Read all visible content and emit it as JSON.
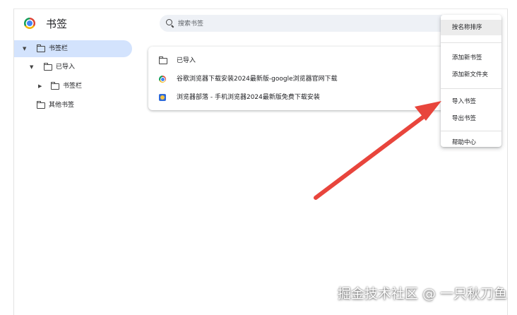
{
  "header": {
    "title": "书签"
  },
  "search": {
    "placeholder": "搜索书签"
  },
  "sidebar": {
    "items": [
      {
        "label": "书签栏",
        "selected": true
      },
      {
        "label": "已导入"
      },
      {
        "label": "书签栏"
      },
      {
        "label": "其他书签"
      }
    ]
  },
  "list": {
    "items": [
      {
        "type": "folder",
        "label": "已导入"
      },
      {
        "type": "bookmark",
        "icon": "chrome-icon",
        "label": "谷歌浏览器下载安装2024最新版-google浏览器官网下载"
      },
      {
        "type": "bookmark",
        "icon": "site-favicon",
        "label": "浏览器部落 - 手机浏览器2024最新版免费下载安装"
      }
    ]
  },
  "menu": {
    "items": [
      {
        "label": "按名称排序"
      },
      {
        "label": "添加新书签"
      },
      {
        "label": "添加新文件夹"
      },
      {
        "label": "导入书签"
      },
      {
        "label": "导出书签"
      },
      {
        "label": "帮助中心"
      }
    ]
  },
  "annotation": {
    "color": "#e8453c"
  },
  "watermark": {
    "text": "掘金技术社区 @ 一只秋刀鱼"
  },
  "colors": {
    "selected_bg": "#d3e3fd",
    "search_bg": "#eef1f6"
  }
}
